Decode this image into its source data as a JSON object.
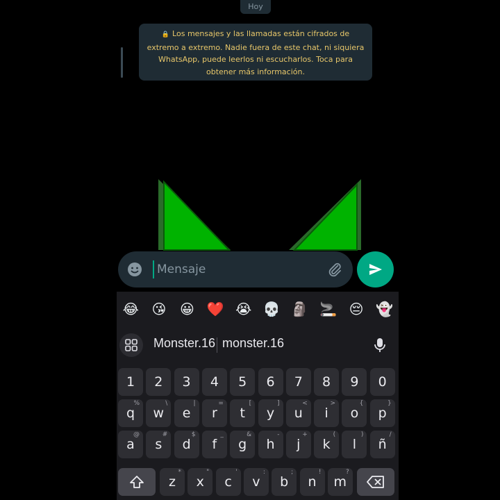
{
  "chat": {
    "date_label": "Hoy",
    "encryption_notice": "Los mensajes y las llamadas están cifrados de extremo a extremo. Nadie fuera de este chat, ni siquiera WhatsApp, puede leerlos ni escucharlos. Toca para obtener más información."
  },
  "composer": {
    "placeholder": "Mensaje",
    "emoji_icon": "emoji-smile-icon",
    "attach_icon": "paperclip-icon",
    "send_icon": "send-arrow-icon"
  },
  "keyboard": {
    "emojis": [
      "😂",
      "😘",
      "😀",
      "❤️",
      "😭",
      "💀",
      "🗿",
      "🚬",
      "😔",
      "👻"
    ],
    "suggestions": [
      "Monster.16",
      "monster.16"
    ],
    "number_row": [
      "1",
      "2",
      "3",
      "4",
      "5",
      "6",
      "7",
      "8",
      "9",
      "0"
    ],
    "row1": [
      {
        "k": "q",
        "s": "%"
      },
      {
        "k": "w",
        "s": "\\"
      },
      {
        "k": "e",
        "s": "|"
      },
      {
        "k": "r",
        "s": "="
      },
      {
        "k": "t",
        "s": "["
      },
      {
        "k": "y",
        "s": "]"
      },
      {
        "k": "u",
        "s": "<"
      },
      {
        "k": "i",
        "s": ">"
      },
      {
        "k": "o",
        "s": "{"
      },
      {
        "k": "p",
        "s": "}"
      }
    ],
    "row2": [
      {
        "k": "a",
        "s": "@"
      },
      {
        "k": "s",
        "s": "#"
      },
      {
        "k": "d",
        "s": "$"
      },
      {
        "k": "f",
        "s": "_"
      },
      {
        "k": "g",
        "s": "&"
      },
      {
        "k": "h",
        "s": "-"
      },
      {
        "k": "j",
        "s": "+"
      },
      {
        "k": "k",
        "s": "("
      },
      {
        "k": "l",
        "s": ")"
      },
      {
        "k": "ñ",
        "s": "/"
      }
    ],
    "row3": [
      {
        "k": "z",
        "s": "*"
      },
      {
        "k": "x",
        "s": "\""
      },
      {
        "k": "c",
        "s": "'"
      },
      {
        "k": "v",
        "s": ":"
      },
      {
        "k": "b",
        "s": ";"
      },
      {
        "k": "n",
        "s": "!"
      },
      {
        "k": "m",
        "s": "?"
      }
    ],
    "shift_icon": "shift-arrow-icon",
    "backspace_icon": "backspace-icon",
    "apps_icon": "grid-apps-icon",
    "mic_icon": "microphone-icon"
  },
  "colors": {
    "accent": "#00a884",
    "bubble": "#1f2c34",
    "notice_text": "#e8c76a",
    "ear_green": "#00b300"
  }
}
